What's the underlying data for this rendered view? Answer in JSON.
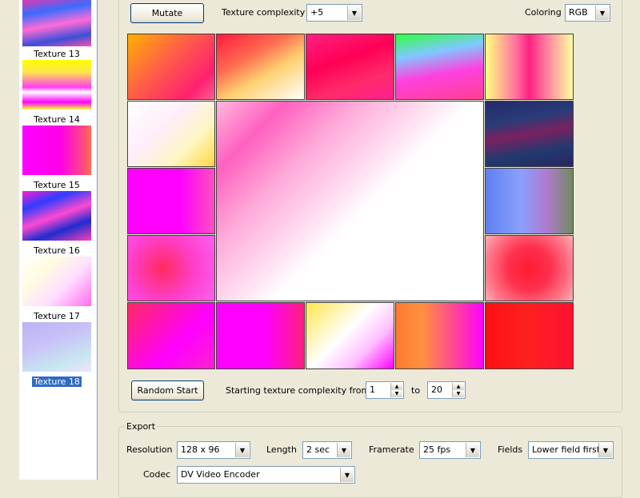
{
  "sidebar": {
    "items": [
      {
        "label": "",
        "bg": "linear-gradient(170deg,#ff2fa0 0%,#3a6cff 30%,#ff6bd6 55%,#3b4fd8 80%,#ff4fb0 100%)"
      },
      {
        "label": "Texture 13",
        "bg": "linear-gradient(180deg,#ffff00 0%,#ffe44d 25%,#ff3df0 55%,#ffffff 65%,#ff00ff 85%,#ffff33 100%)"
      },
      {
        "label": "Texture 14",
        "bg": "linear-gradient(90deg,#ff00ff 0%,#ff00e8 55%,#ff4090 85%,#ff7050 100%)"
      },
      {
        "label": "Texture 15",
        "bg": "linear-gradient(160deg,#ff1fd0 0%,#2d3dff 25%,#ff48d0 50%,#1e2ccf 72%,#ff3fb8 100%)"
      },
      {
        "label": "Texture 16",
        "bg": "linear-gradient(135deg,#ffffff 0%,#fffbe0 30%,#ffe0ff 60%,#ff6ff0 100%)"
      },
      {
        "label": "Texture 17",
        "bg": "linear-gradient(160deg,#b8b4f2 0%,#c9c2f8 40%,#c7e6f0 75%,#f0e4ff 100%)"
      },
      {
        "label": "Texture 18",
        "selected": true
      }
    ]
  },
  "toolbar": {
    "mutate_label": "Mutate",
    "complexity_label": "Texture complexity",
    "complexity_value": "+5",
    "coloring_label": "Coloring",
    "coloring_value": "RGB"
  },
  "grid": {
    "cells": [
      {
        "bg": "linear-gradient(135deg,#ffb000 0%,#ff5a4a 45%,#ff2070 80%,#ff6090 100%)"
      },
      {
        "bg": "linear-gradient(150deg,#ff1a40 0%,#ff6b50 35%,#ffd070 60%,#ffffff 100%)"
      },
      {
        "bg": "linear-gradient(160deg,#ff2080 0%,#ff0055 40%,#ff2a6a 70%,#ff1f8f 100%)"
      },
      {
        "bg": "linear-gradient(170deg,#30ff40 0%,#80c8ff 30%,#ff40e0 60%,#ff4090 100%)"
      },
      {
        "bg": "linear-gradient(90deg,#ffff80 0%,#ff70a0 35%,#ff2080 50%,#ff80a0 70%,#ffffa0 100%)"
      },
      {
        "bg": "linear-gradient(135deg,#ffffff 0%,#ffeefa 40%,#fff6c0 70%,#ffd840 100%)"
      },
      {
        "bg": "linear-gradient(135deg,#ff4fa0 0%,#ff2f8f 10%,#ffa8c8 30%,#ffffff 55%,#ffffff 100%)"
      },
      {
        "bg": "linear-gradient(170deg,#252a6a 0%,#2a3c78 30%,#7a2060 50%,#203a70 75%,#2a2560 100%)"
      },
      {
        "bg": "linear-gradient(90deg,#ff00ff 0%,#ff00ff 60%,#ff50c0 100%)"
      },
      {
        "bg": "linear-gradient(90deg,#5f7ff0 0%,#8aa0ff 40%,#b07ad0 70%,#6f8a60 100%)"
      },
      {
        "bg": "radial-gradient(circle at 40% 50%,#ff2a60 0%,#ff40d0 55%,#ff60f0 100%)"
      },
      {
        "bg": "radial-gradient(circle at 50% 50%,#ff1a30 0%,#ff3050 40%,#ff8090 80%,#ffb0b8 100%)"
      },
      {
        "bg": "linear-gradient(135deg,#ff2a60 0%,#ff00ff 60%,#ff20d0 100%)"
      },
      {
        "bg": "linear-gradient(90deg,#ff00ff 0%,#ff00ff 55%,#ff2080 100%)"
      },
      {
        "bg": "linear-gradient(135deg,#ffe850 0%,#fff4b0 25%,#ffffff 45%,#ffc0ff 70%,#ff00ff 100%)"
      },
      {
        "bg": "linear-gradient(90deg,#ff7a30 0%,#ff9040 30%,#ff40a0 70%,#ff00ff 100%)"
      },
      {
        "bg": "linear-gradient(90deg,#ff1010 0%,#ff2020 50%,#ff1030 100%)"
      }
    ],
    "main_bg": "linear-gradient(135deg,#ffb8e0 0%,#ff60c0 15%,#ffa8d8 30%,#ffffff 55%,#ffffff 100%)"
  },
  "bottom": {
    "random_start_label": "Random Start",
    "starting_label": "Starting texture complexity from",
    "from_value": "1",
    "to_label": "to",
    "to_value": "20"
  },
  "export": {
    "title": "Export",
    "resolution_label": "Resolution",
    "resolution_value": "128 x 96",
    "length_label": "Length",
    "length_value": "2 sec",
    "framerate_label": "Framerate",
    "framerate_value": "25 fps",
    "fields_label": "Fields",
    "fields_value": "Lower field first",
    "codec_label": "Codec",
    "codec_value": "DV Video Encoder"
  }
}
